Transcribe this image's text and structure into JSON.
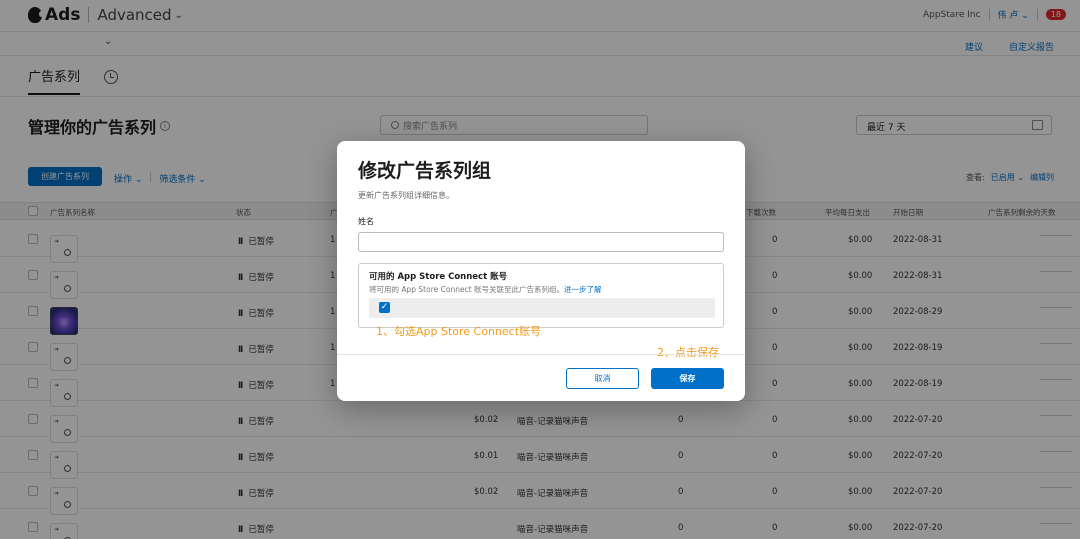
{
  "header": {
    "brand": "Ads",
    "mode": "Advanced",
    "org": "AppStare Inc",
    "user": "伟 卢",
    "notifications": "18"
  },
  "subnav": {
    "suggestions": "建议",
    "custom_reports": "自定义报告"
  },
  "tabs": {
    "campaigns": "广告系列"
  },
  "page": {
    "title": "管理你的广告系列",
    "search_placeholder": "搜索广告系列",
    "date_range": "最近 7 天"
  },
  "toolbar": {
    "create": "创建广告系列",
    "actions": "操作",
    "filters": "筛选条件",
    "view_label": "查看:",
    "view_value": "已启用",
    "edit_columns": "编辑列"
  },
  "table": {
    "columns": {
      "name": "广告系列名称",
      "status": "状态",
      "c3": "广",
      "c7": "下载次数",
      "avg_daily": "平均每日支出",
      "start": "开始日期",
      "remaining": "广告系列剩余的天数"
    },
    "rows": [
      {
        "status": "已暂停",
        "c3": "1",
        "c4": "",
        "c5": "",
        "c6": "",
        "downloads": "0",
        "avg": "$0.00",
        "start": "2022-08-31"
      },
      {
        "status": "已暂停",
        "c3": "1",
        "c4": "",
        "c5": "",
        "c6": "",
        "downloads": "0",
        "avg": "$0.00",
        "start": "2022-08-31"
      },
      {
        "status": "已暂停",
        "c3": "1",
        "c4": "",
        "c5": "",
        "c6": "",
        "downloads": "0",
        "avg": "$0.00",
        "start": "2022-08-29"
      },
      {
        "status": "已暂停",
        "c3": "1",
        "c4": "",
        "c5": "",
        "c6": "",
        "downloads": "0",
        "avg": "$0.00",
        "start": "2022-08-19"
      },
      {
        "status": "已暂停",
        "c3": "1",
        "c4": "",
        "c5": "",
        "c6": "",
        "downloads": "0",
        "avg": "$0.00",
        "start": "2022-08-19"
      },
      {
        "status": "已暂停",
        "c3": "",
        "c4": "$0.02",
        "c5": "喵音-记录猫咪声音",
        "c6": "0",
        "downloads": "0",
        "avg": "$0.00",
        "start": "2022-07-20"
      },
      {
        "status": "已暂停",
        "c3": "",
        "c4": "$0.01",
        "c5": "喵音-记录猫咪声音",
        "c6": "0",
        "downloads": "0",
        "avg": "$0.00",
        "start": "2022-07-20"
      },
      {
        "status": "已暂停",
        "c3": "",
        "c4": "$0.02",
        "c5": "喵音-记录猫咪声音",
        "c6": "0",
        "downloads": "0",
        "avg": "$0.00",
        "start": "2022-07-20"
      },
      {
        "status": "已暂停",
        "c3": "",
        "c4": "",
        "c5": "喵音-记录猫咪声音",
        "c6": "0",
        "downloads": "0",
        "avg": "$0.00",
        "start": "2022-07-20"
      }
    ]
  },
  "modal": {
    "title": "修改广告系列组",
    "subtitle": "更新广告系列组详细信息。",
    "name_label": "姓名",
    "name_value": "",
    "asc_title": "可用的 App Store Connect 账号",
    "asc_desc": "将可用的 App Store Connect 账号关联至此广告系列组。",
    "asc_link": "进一步了解",
    "checkbox_checked": true,
    "annotation1": "1、勾选App Store Connect账号",
    "annotation2": "2、点击保存",
    "cancel": "取消",
    "save": "保存"
  },
  "colors": {
    "accent": "#0070c9",
    "annotation": "#f29b1c",
    "badge": "#e0282e"
  }
}
